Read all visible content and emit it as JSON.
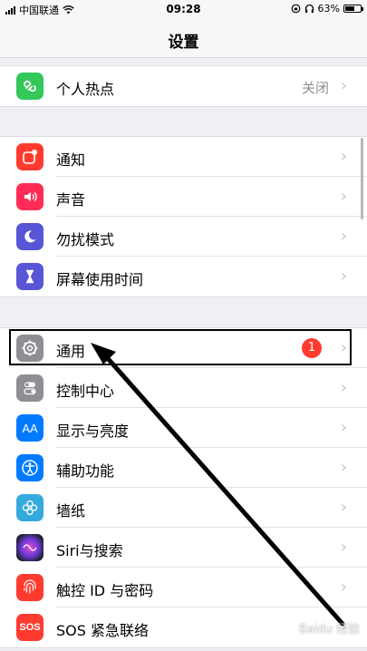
{
  "status_bar": {
    "carrier": "中国联通",
    "time": "09:28",
    "battery_percent": "63%",
    "battery_level": 0.63
  },
  "nav": {
    "title": "设置"
  },
  "groups": {
    "hotspot": [
      {
        "label": "个人热点",
        "value": "关闭",
        "icon": "hotspot-icon",
        "color": "#34c759"
      }
    ],
    "notifications": [
      {
        "label": "通知",
        "icon": "notifications-icon",
        "color": "#ff3b30"
      },
      {
        "label": "声音",
        "icon": "sounds-icon",
        "color": "#ff2d55"
      },
      {
        "label": "勿扰模式",
        "icon": "moon-icon",
        "color": "#5856d6"
      },
      {
        "label": "屏幕使用时间",
        "icon": "hourglass-icon",
        "color": "#5856d6"
      }
    ],
    "general": [
      {
        "label": "通用",
        "icon": "gear-icon",
        "color": "#8e8e93",
        "badge": "1"
      },
      {
        "label": "控制中心",
        "icon": "toggles-icon",
        "color": "#8e8e93"
      },
      {
        "label": "显示与亮度",
        "icon": "display-icon",
        "color": "#007aff",
        "icon_text": "AA"
      },
      {
        "label": "辅助功能",
        "icon": "accessibility-icon",
        "color": "#007aff"
      },
      {
        "label": "墙纸",
        "icon": "wallpaper-icon",
        "color": "#34aadc"
      },
      {
        "label": "Siri与搜索",
        "icon": "siri-icon",
        "color": "#222222"
      },
      {
        "label": "触控 ID 与密码",
        "icon": "fingerprint-icon",
        "color": "#ff3b30"
      },
      {
        "label": "SOS 紧急联络",
        "icon": "sos-icon",
        "color": "#ff3b30",
        "icon_text": "SOS"
      }
    ]
  },
  "watermark": "Baidu 经验"
}
